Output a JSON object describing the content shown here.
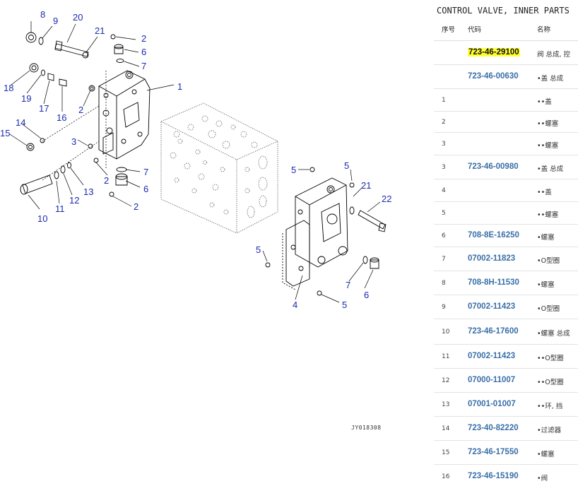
{
  "diagram": {
    "callouts": [
      "8",
      "9",
      "20",
      "21",
      "2",
      "6",
      "7",
      "1",
      "18",
      "19",
      "17",
      "16",
      "2",
      "14",
      "15",
      "3",
      "2",
      "7",
      "6",
      "2",
      "10",
      "11",
      "12",
      "13",
      "5",
      "5",
      "21",
      "22",
      "5",
      "7",
      "6",
      "4",
      "5"
    ],
    "drawing_code": "JY018308"
  },
  "parts_panel": {
    "title": "CONTROL VALVE, INNER PARTS",
    "headers": {
      "seq": "序号",
      "code": "代码",
      "name": "名称"
    },
    "rows": [
      {
        "seq": "",
        "code": "723-46-29100",
        "name": "阀 总成, 控",
        "highlighted": true
      },
      {
        "seq": "",
        "code": "723-46-00630",
        "name": "•盖 总成"
      },
      {
        "seq": "1",
        "code": "",
        "name": "••盖"
      },
      {
        "seq": "2",
        "code": "",
        "name": "••螺塞"
      },
      {
        "seq": "3",
        "code": "",
        "name": "••螺塞"
      },
      {
        "seq": "3",
        "code": "723-46-00980",
        "name": "•盖 总成"
      },
      {
        "seq": "4",
        "code": "",
        "name": "••盖"
      },
      {
        "seq": "5",
        "code": "",
        "name": "••螺塞"
      },
      {
        "seq": "6",
        "code": "708-8E-16250",
        "name": "•螺塞"
      },
      {
        "seq": "7",
        "code": "07002-11823",
        "name": "•O型圈"
      },
      {
        "seq": "8",
        "code": "708-8H-11530",
        "name": "•螺塞"
      },
      {
        "seq": "9",
        "code": "07002-11423",
        "name": "•O型圈"
      },
      {
        "seq": "10",
        "code": "723-46-17600",
        "name": "•螺塞 总成"
      },
      {
        "seq": "11",
        "code": "07002-11423",
        "name": "••O型圈"
      },
      {
        "seq": "12",
        "code": "07000-11007",
        "name": "••O型圈"
      },
      {
        "seq": "13",
        "code": "07001-01007",
        "name": "••环, 挡"
      },
      {
        "seq": "14",
        "code": "723-40-82220",
        "name": "•过滤器"
      },
      {
        "seq": "15",
        "code": "723-46-17550",
        "name": "•螺塞"
      },
      {
        "seq": "16",
        "code": "723-46-15190",
        "name": "•阀"
      }
    ]
  }
}
